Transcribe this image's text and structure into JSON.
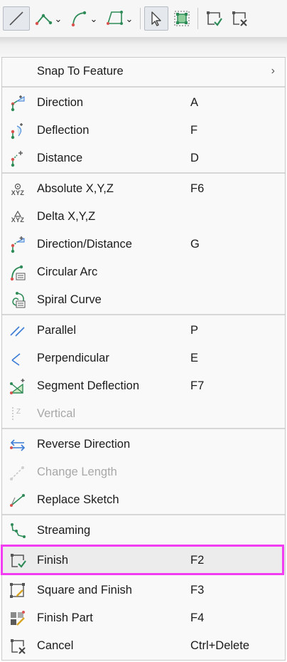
{
  "toolbar": {
    "buttons": [
      {
        "name": "line-tool",
        "icon": "straight-segment-icon",
        "active": true
      },
      {
        "name": "midpoint-tool",
        "icon": "midpoint-icon",
        "has_dropdown": true
      },
      {
        "name": "arc-tool",
        "icon": "arc-segment-icon",
        "has_dropdown": true
      },
      {
        "name": "polygon-tool",
        "icon": "polygon-icon",
        "has_dropdown": true
      },
      {
        "name": "select-tool",
        "icon": "pointer-icon",
        "active": true
      },
      {
        "name": "edit-vertices-tool",
        "icon": "edit-vertices-icon"
      },
      {
        "name": "finish-tool",
        "icon": "finish-sketch-icon"
      },
      {
        "name": "cancel-tool",
        "icon": "cancel-sketch-icon"
      }
    ]
  },
  "menu": {
    "snap_to_feature": {
      "label": "Snap To Feature"
    },
    "direction": {
      "label": "Direction",
      "shortcut": "A"
    },
    "deflection": {
      "label": "Deflection",
      "shortcut": "F"
    },
    "distance": {
      "label": "Distance",
      "shortcut": "D"
    },
    "absolute_xyz": {
      "label": "Absolute X,Y,Z",
      "shortcut": "F6",
      "icon_text": "XYZ"
    },
    "delta_xyz": {
      "label": "Delta X,Y,Z",
      "icon_text": "XYZ"
    },
    "direction_distance": {
      "label": "Direction/Distance",
      "shortcut": "G"
    },
    "circular_arc": {
      "label": "Circular Arc"
    },
    "spiral_curve": {
      "label": "Spiral Curve"
    },
    "parallel": {
      "label": "Parallel",
      "shortcut": "P"
    },
    "perpendicular": {
      "label": "Perpendicular",
      "shortcut": "E"
    },
    "segment_deflection": {
      "label": "Segment Deflection",
      "shortcut": "F7"
    },
    "vertical": {
      "label": "Vertical",
      "disabled": true
    },
    "reverse_direction": {
      "label": "Reverse Direction"
    },
    "change_length": {
      "label": "Change Length",
      "disabled": true
    },
    "replace_sketch": {
      "label": "Replace Sketch"
    },
    "streaming": {
      "label": "Streaming"
    },
    "finish": {
      "label": "Finish",
      "shortcut": "F2",
      "highlighted": true
    },
    "square_and_finish": {
      "label": "Square and Finish",
      "shortcut": "F3"
    },
    "finish_part": {
      "label": "Finish Part",
      "shortcut": "F4"
    },
    "cancel": {
      "label": "Cancel",
      "shortcut": "Ctrl+Delete"
    }
  },
  "colors": {
    "highlight_border": "#f23cf2",
    "icon_green": "#2e8b57",
    "icon_blue": "#3a7bd5",
    "icon_red": "#d9534f",
    "disabled_text": "#a8a8a8"
  }
}
